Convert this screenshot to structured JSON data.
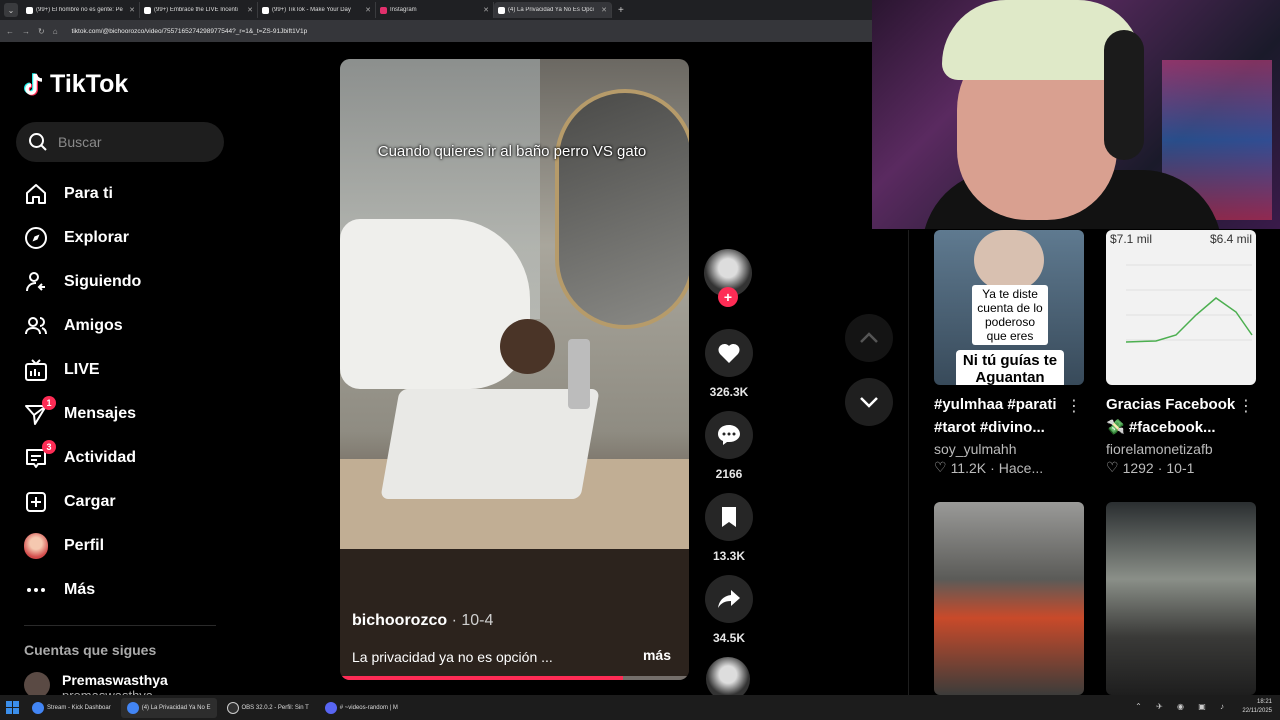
{
  "browser": {
    "tabs": [
      {
        "title": "(99+) El hombre no es gente: Pe",
        "active": false,
        "fav": "tiktok"
      },
      {
        "title": "(99+) Embrace the LIVE Incenti",
        "active": false,
        "fav": "tiktok"
      },
      {
        "title": "(99+) TikTok - Make Your Day",
        "active": false,
        "fav": "tiktok"
      },
      {
        "title": "Instagram",
        "active": false,
        "fav": "instagram"
      },
      {
        "title": "(4) La Privacidad Ya No Es Opci",
        "active": true,
        "fav": "tiktok"
      }
    ],
    "url": "tiktok.com/@bichoorozco/video/7557165274298977544?_r=1&_t=ZS-91Jbift1V1p"
  },
  "sidebar": {
    "logo": "TikTok",
    "search_placeholder": "Buscar",
    "nav": [
      {
        "label": "Para ti",
        "icon": "home-icon"
      },
      {
        "label": "Explorar",
        "icon": "compass-icon"
      },
      {
        "label": "Siguiendo",
        "icon": "following-icon"
      },
      {
        "label": "Amigos",
        "icon": "friends-icon"
      },
      {
        "label": "LIVE",
        "icon": "live-icon"
      },
      {
        "label": "Mensajes",
        "icon": "messages-icon",
        "badge": "1"
      },
      {
        "label": "Actividad",
        "icon": "activity-icon",
        "badge": "3"
      },
      {
        "label": "Cargar",
        "icon": "upload-icon"
      },
      {
        "label": "Perfil",
        "icon": "profile-avatar"
      },
      {
        "label": "Más",
        "icon": "more-icon"
      }
    ],
    "following_title": "Cuentas que sigues",
    "following": [
      {
        "name": "Premaswasthya",
        "handle": "premaswasthya"
      }
    ]
  },
  "video": {
    "overlay_text": "Cuando quieres ir al baño perro VS gato",
    "author": "bichoorozco",
    "date": "10-4",
    "caption": "La privacidad ya no es opción ...",
    "more": "más",
    "progress": 0.81
  },
  "actions": {
    "likes": "326.3K",
    "comments": "2166",
    "saves": "13.3K",
    "shares": "34.5K"
  },
  "recommended": [
    {
      "title": "#yulmhaa #parati #tarot #divino...",
      "author": "soy_yulmahh",
      "likes": "11.2K",
      "time": "Hace...",
      "thumb_text": "Ya te diste cuenta de lo poderoso que eres",
      "thumb_big": "Ni tú guías te Aguantan"
    },
    {
      "title": "Gracias Facebook 💸 #facebook...",
      "author": "fiorelamonetizafb",
      "likes": "1292",
      "time": "10-1",
      "chart_left": "$7.1 mil",
      "chart_right": "$6.4 mil"
    },
    {
      "title": "",
      "author": "",
      "likes": "",
      "time": ""
    },
    {
      "title": "",
      "author": "",
      "likes": "",
      "time": ""
    }
  ],
  "taskbar": {
    "apps": [
      {
        "label": "Stream - Kick Dashboar",
        "active": false
      },
      {
        "label": "(4) La Privacidad Ya No E",
        "active": true
      },
      {
        "label": "OBS 32.0.2 - Perfil: Sin T",
        "active": false
      },
      {
        "label": "# ~videos-random | M",
        "active": false
      }
    ],
    "time": "18:21",
    "date": "22/11/2025"
  },
  "colors": {
    "accent": "#fe2c55",
    "background": "#000000"
  }
}
